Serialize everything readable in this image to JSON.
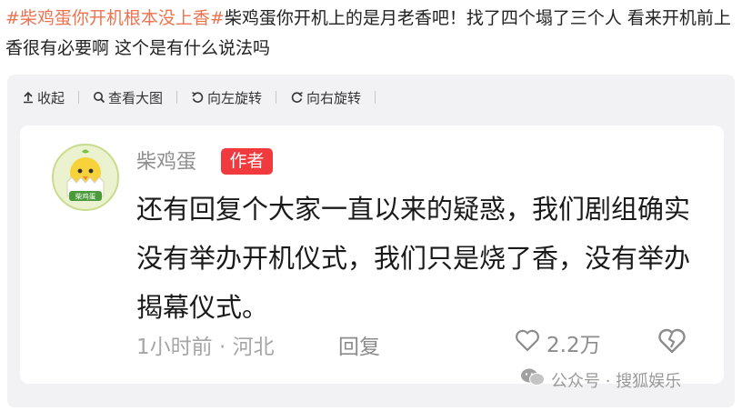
{
  "post": {
    "hashtag": "#柴鸡蛋你开机根本没上香#",
    "body": "柴鸡蛋你开机上的是月老香吧！找了四个塌了三个人 看来开机前上香很有必要啊 这个是有什么说法吗"
  },
  "toolbar": {
    "collapse_label": "收起",
    "view_large_label": "查看大图",
    "rotate_left_label": "向左旋转",
    "rotate_right_label": "向右旋转"
  },
  "comment": {
    "author": "柴鸡蛋",
    "author_badge": "作者",
    "text": "还有回复个大家一直以来的疑惑，我们剧组确实没有举办开机仪式，我们只是烧了香，没有举办揭幕仪式。",
    "time": "1小时前",
    "location": "河北",
    "meta_separator": "·",
    "reply_label": "回复",
    "like_count": "2.2万",
    "avatar_badge_text": "柴鸡蛋"
  },
  "watermark": {
    "text": "公众号 · 搜狐娱乐"
  },
  "colors": {
    "hashtag": "#eb7350",
    "badge": "#f03a3e",
    "panel": "#f2f2f5"
  },
  "icons": [
    "collapse-arrow-icon",
    "search-icon",
    "rotate-left-icon",
    "rotate-right-icon",
    "heart-icon",
    "broken-heart-icon",
    "wechat-icon"
  ]
}
